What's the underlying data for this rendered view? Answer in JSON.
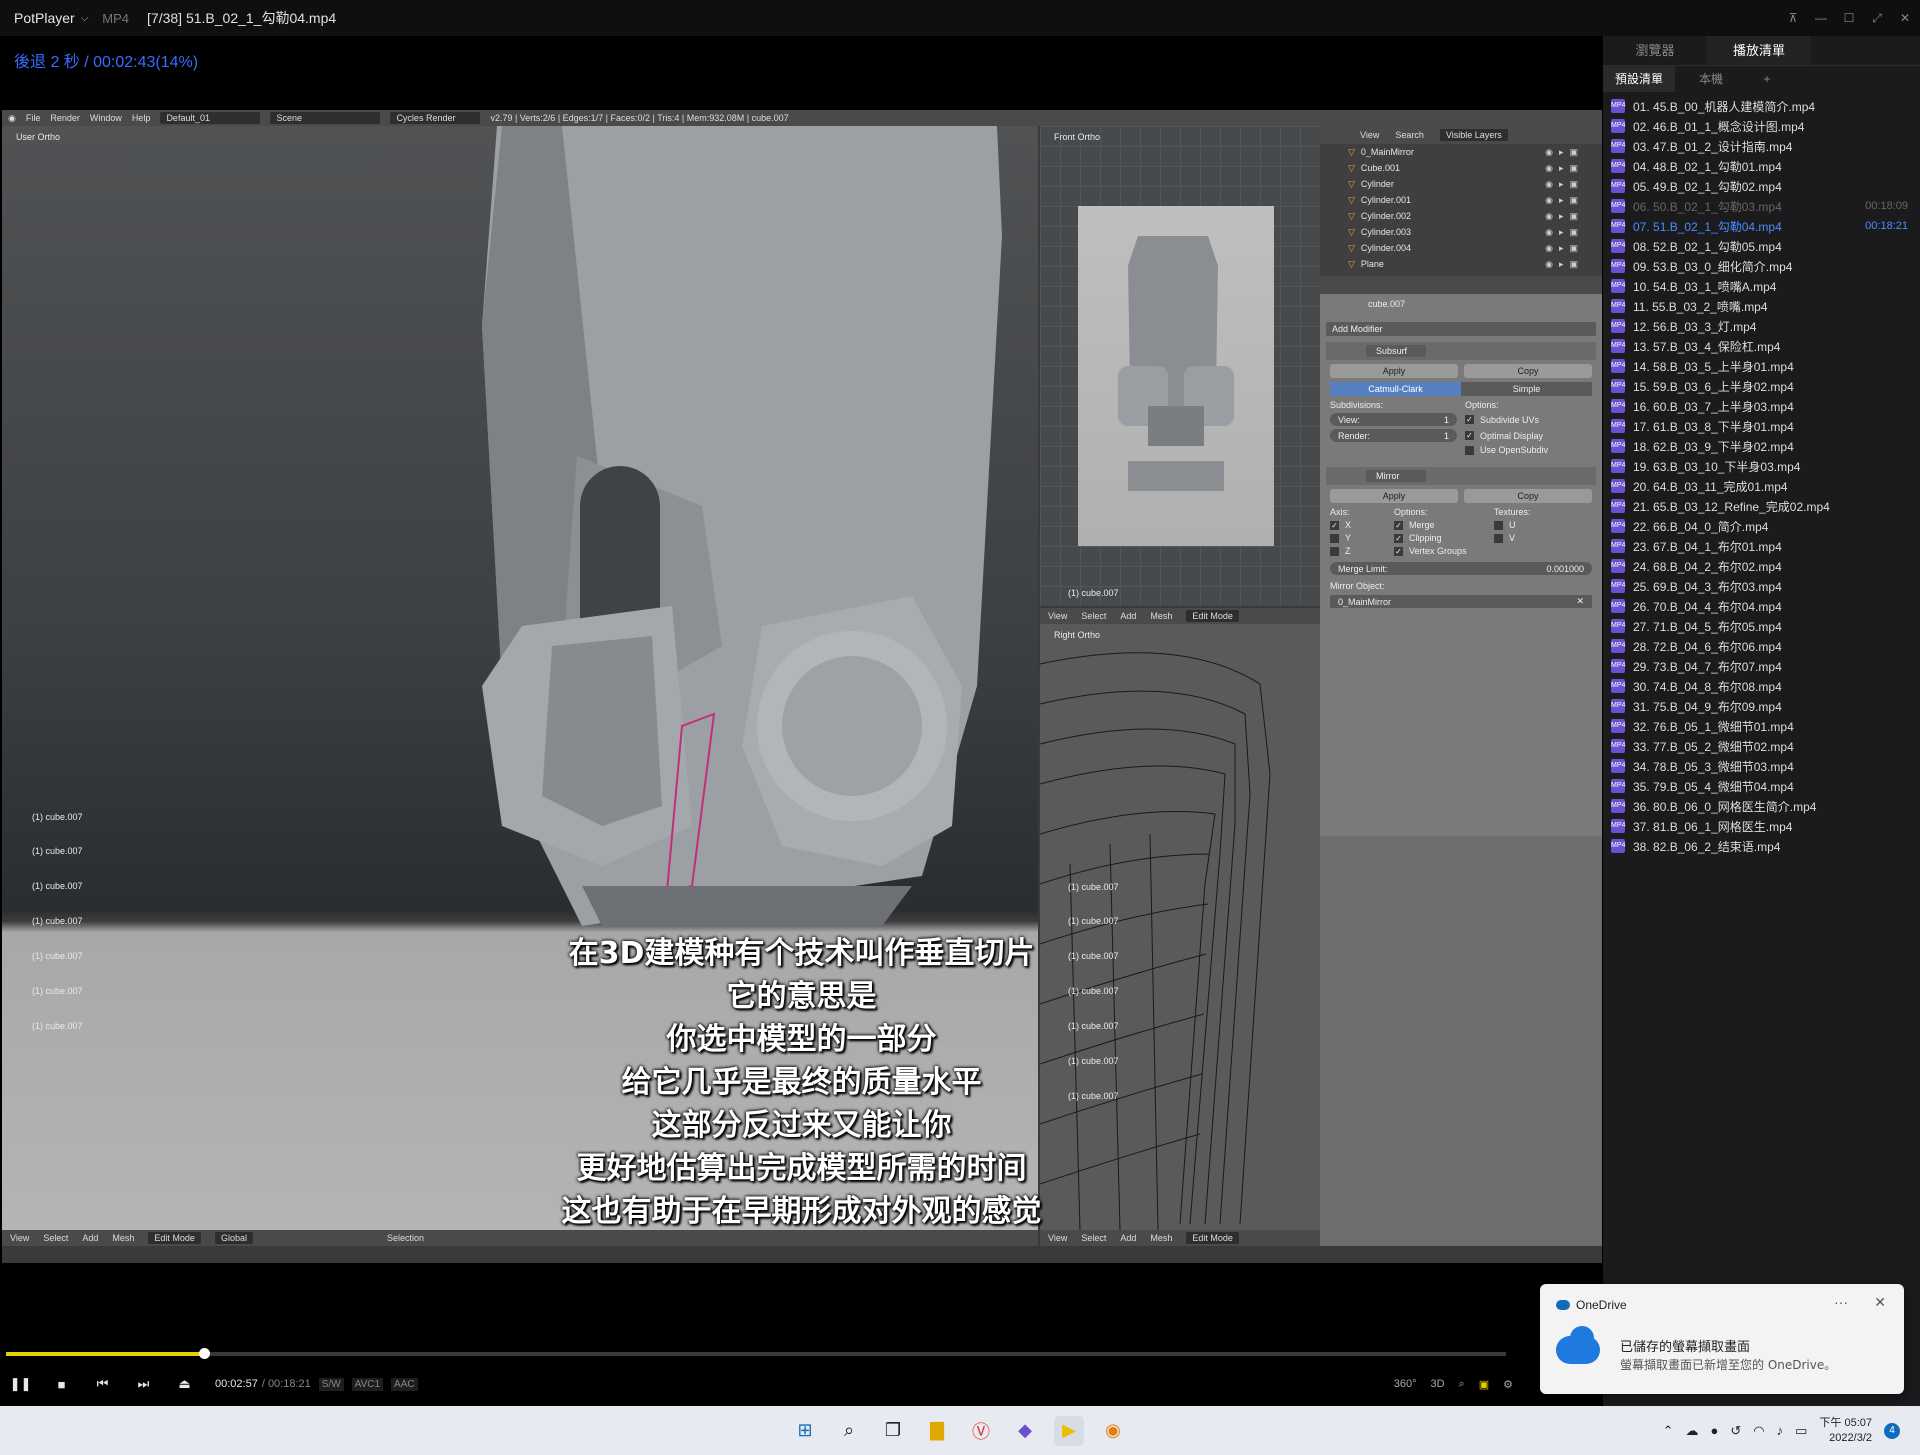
{
  "titlebar": {
    "app": "PotPlayer",
    "format": "MP4",
    "file": "[7/38] 51.B_02_1_勾勒04.mp4"
  },
  "osd": "後退 2 秒 / 00:02:43(14%)",
  "blender": {
    "menu": [
      "File",
      "Render",
      "Window",
      "Help"
    ],
    "layout": "Default_01",
    "scene": "Scene",
    "engine": "Cycles Render",
    "status": "v2.79 | Verts:2/6 | Edges:1/7 | Faces:0/2 | Tris:4 | Mem:932.08M | cube.007",
    "main_view_label": "User Ortho",
    "front_view_label": "Front Ortho",
    "right_view_label": "Right Ortho",
    "object_label": "(1) cube.007",
    "main_bar": {
      "items": [
        "View",
        "Select",
        "Add",
        "Mesh"
      ],
      "mode": "Edit Mode",
      "orientation": "Global",
      "selection": "Selection"
    },
    "side_bar": {
      "items": [
        "View",
        "Select",
        "Add",
        "Mesh"
      ],
      "mode": "Edit Mode"
    },
    "outliner": {
      "header": [
        "View",
        "Search"
      ],
      "filter": "Visible Layers",
      "items": [
        "0_MainMirror",
        "Cube.001",
        "Cylinder",
        "Cylinder.001",
        "Cylinder.002",
        "Cylinder.003",
        "Cylinder.004",
        "Plane"
      ]
    },
    "props": {
      "object": "cube.007",
      "add_modifier": "Add Modifier",
      "subsurf": {
        "name": "Subsurf",
        "apply": "Apply",
        "copy": "Copy",
        "catmull": "Catmull-Clark",
        "simple": "Simple",
        "subdivisions": "Subdivisions:",
        "options": "Options:",
        "view_label": "View:",
        "view_val": "1",
        "render_label": "Render:",
        "render_val": "1",
        "subdivide_uvs": "Subdivide UVs",
        "optimal_display": "Optimal Display",
        "use_opensubdiv": "Use OpenSubdiv"
      },
      "mirror": {
        "name": "Mirror",
        "apply": "Apply",
        "copy": "Copy",
        "axis": "Axis:",
        "options": "Options:",
        "textures": "Textures:",
        "x": "X",
        "y": "Y",
        "z": "Z",
        "merge": "Merge",
        "clipping": "Clipping",
        "vertex_groups": "Vertex Groups",
        "u": "U",
        "v": "V",
        "merge_limit": "Merge Limit:",
        "merge_limit_val": "0.001000",
        "mirror_object": "Mirror Object:",
        "mirror_object_val": "0_MainMirror"
      }
    }
  },
  "subtitles": [
    "在3D建模种有个技术叫作垂直切片",
    "它的意思是",
    "你选中模型的一部分",
    "给它几乎是最终的质量水平",
    "这部分反过来又能让你",
    "更好地估算出完成模型所需的时间",
    "这也有助于在早期形成对外观的感觉"
  ],
  "controls": {
    "current": "00:02:57",
    "total": "/ 00:18:21",
    "tags": [
      "S/W",
      "AVC1",
      "AAC"
    ],
    "progress_fraction": 0.132,
    "right": [
      "360°",
      "3D"
    ]
  },
  "playlist": {
    "tabs": [
      "瀏覽器",
      "播放清單"
    ],
    "subtabs": [
      "預設清單",
      "本機",
      "+"
    ],
    "current_index": 6,
    "items": [
      {
        "name": "01. 45.B_00_机器人建模简介.mp4",
        "dur": ""
      },
      {
        "name": "02. 46.B_01_1_概念设计图.mp4",
        "dur": ""
      },
      {
        "name": "03. 47.B_01_2_设计指南.mp4",
        "dur": ""
      },
      {
        "name": "04. 48.B_02_1_勾勒01.mp4",
        "dur": ""
      },
      {
        "name": "05. 49.B_02_1_勾勒02.mp4",
        "dur": ""
      },
      {
        "name": "06. 50.B_02_1_勾勒03.mp4",
        "dur": "00:18:09"
      },
      {
        "name": "07. 51.B_02_1_勾勒04.mp4",
        "dur": "00:18:21"
      },
      {
        "name": "08. 52.B_02_1_勾勒05.mp4",
        "dur": ""
      },
      {
        "name": "09. 53.B_03_0_细化简介.mp4",
        "dur": ""
      },
      {
        "name": "10. 54.B_03_1_喷嘴A.mp4",
        "dur": ""
      },
      {
        "name": "11. 55.B_03_2_喷嘴.mp4",
        "dur": ""
      },
      {
        "name": "12. 56.B_03_3_灯.mp4",
        "dur": ""
      },
      {
        "name": "13. 57.B_03_4_保险杠.mp4",
        "dur": ""
      },
      {
        "name": "14. 58.B_03_5_上半身01.mp4",
        "dur": ""
      },
      {
        "name": "15. 59.B_03_6_上半身02.mp4",
        "dur": ""
      },
      {
        "name": "16. 60.B_03_7_上半身03.mp4",
        "dur": ""
      },
      {
        "name": "17. 61.B_03_8_下半身01.mp4",
        "dur": ""
      },
      {
        "name": "18. 62.B_03_9_下半身02.mp4",
        "dur": ""
      },
      {
        "name": "19. 63.B_03_10_下半身03.mp4",
        "dur": ""
      },
      {
        "name": "20. 64.B_03_11_完成01.mp4",
        "dur": ""
      },
      {
        "name": "21. 65.B_03_12_Refine_完成02.mp4",
        "dur": ""
      },
      {
        "name": "22. 66.B_04_0_简介.mp4",
        "dur": ""
      },
      {
        "name": "23. 67.B_04_1_布尔01.mp4",
        "dur": ""
      },
      {
        "name": "24. 68.B_04_2_布尔02.mp4",
        "dur": ""
      },
      {
        "name": "25. 69.B_04_3_布尔03.mp4",
        "dur": ""
      },
      {
        "name": "26. 70.B_04_4_布尔04.mp4",
        "dur": ""
      },
      {
        "name": "27. 71.B_04_5_布尔05.mp4",
        "dur": ""
      },
      {
        "name": "28. 72.B_04_6_布尔06.mp4",
        "dur": ""
      },
      {
        "name": "29. 73.B_04_7_布尔07.mp4",
        "dur": ""
      },
      {
        "name": "30. 74.B_04_8_布尔08.mp4",
        "dur": ""
      },
      {
        "name": "31. 75.B_04_9_布尔09.mp4",
        "dur": ""
      },
      {
        "name": "32. 76.B_05_1_微细节01.mp4",
        "dur": ""
      },
      {
        "name": "33. 77.B_05_2_微细节02.mp4",
        "dur": ""
      },
      {
        "name": "34. 78.B_05_3_微细节03.mp4",
        "dur": ""
      },
      {
        "name": "35. 79.B_05_4_微细节04.mp4",
        "dur": ""
      },
      {
        "name": "36. 80.B_06_0_网格医生简介.mp4",
        "dur": ""
      },
      {
        "name": "37. 81.B_06_1_网格医生.mp4",
        "dur": ""
      },
      {
        "name": "38. 82.B_06_2_结束语.mp4",
        "dur": ""
      }
    ]
  },
  "toast": {
    "app": "OneDrive",
    "more": "···",
    "close": "✕",
    "title": "已儲存的螢幕擷取畫面",
    "body": "螢幕擷取畫面已新增至您的 OneDrive。"
  },
  "taskbar": {
    "time": "下午 05:07",
    "date": "2022/3/2",
    "notifications": "4"
  },
  "colors": {
    "accent": "#4b8dff",
    "seek": "#e8d000",
    "playlist_icon": "#6a4fcf",
    "selection_edge": "#c0307a"
  }
}
